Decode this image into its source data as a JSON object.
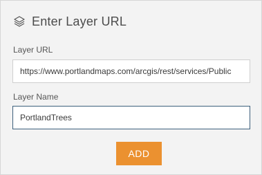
{
  "header": {
    "title": "Enter Layer URL",
    "icon": "layers-icon"
  },
  "form": {
    "url_label": "Layer URL",
    "url_value": "https://www.portlandmaps.com/arcgis/rest/services/Public",
    "name_label": "Layer Name",
    "name_value": "PortlandTrees"
  },
  "actions": {
    "add_label": "ADD"
  },
  "colors": {
    "accent": "#eb9130",
    "panel_background": "#f3f3f3",
    "focus_border": "#3c5f7c"
  }
}
